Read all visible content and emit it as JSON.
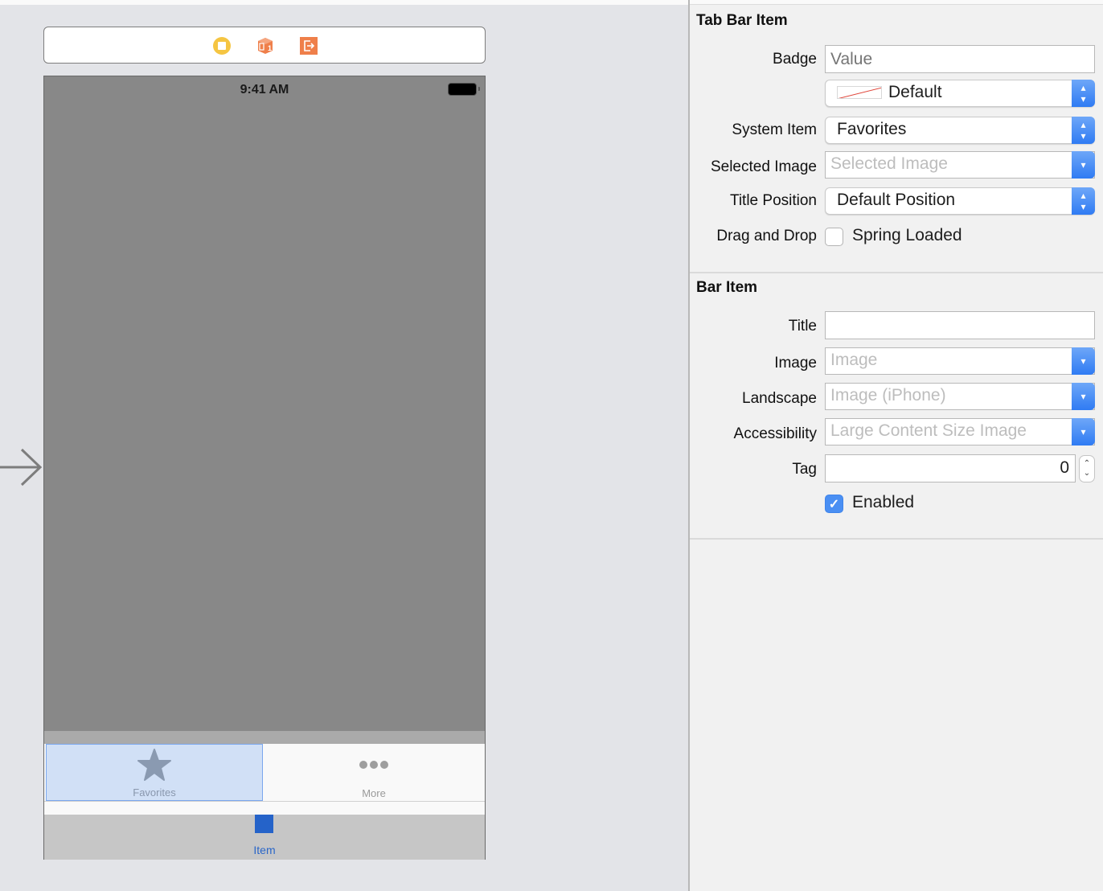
{
  "canvas": {
    "scene_dock": {
      "icons": [
        "view-controller-icon",
        "first-responder-icon",
        "exit-icon"
      ],
      "first_responder_badge": "1"
    },
    "device": {
      "status_time": "9:41 AM",
      "tab_bar": {
        "items": [
          {
            "label": "Favorites",
            "icon": "star-icon",
            "selected": true
          },
          {
            "label": "More",
            "icon": "more-dots-icon",
            "selected": false
          }
        ]
      },
      "bottom_item_label": "Item"
    }
  },
  "inspector": {
    "tab_bar_item": {
      "title": "Tab Bar Item",
      "badge_label": "Badge",
      "badge_placeholder": "Value",
      "badge_value": "",
      "badge_color": "Default",
      "system_item_label": "System Item",
      "system_item_value": "Favorites",
      "selected_image_label": "Selected Image",
      "selected_image_placeholder": "Selected Image",
      "title_position_label": "Title Position",
      "title_position_value": "Default Position",
      "drag_drop_label": "Drag and Drop",
      "spring_loaded_label": "Spring Loaded",
      "spring_loaded_checked": false
    },
    "bar_item": {
      "title": "Bar Item",
      "title_label": "Title",
      "title_value": "",
      "image_label": "Image",
      "image_placeholder": "Image",
      "landscape_label": "Landscape",
      "landscape_placeholder": "Image (iPhone)",
      "accessibility_label": "Accessibility",
      "accessibility_placeholder": "Large Content Size Image",
      "tag_label": "Tag",
      "tag_value": "0",
      "enabled_label": "Enabled",
      "enabled_checked": true
    }
  },
  "colors": {
    "accent_blue": "#2f7bf3",
    "item_blue": "#2563c9",
    "selection_fill": "#d1e0f6",
    "vc_icon_yellow": "#f5c542",
    "scene_icon_orange": "#ef7f4a"
  }
}
